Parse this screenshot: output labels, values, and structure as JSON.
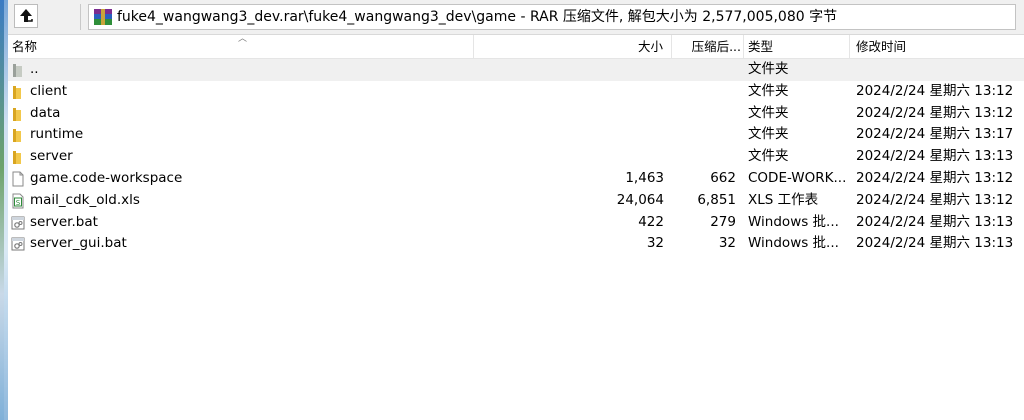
{
  "address": {
    "path_text": "fuke4_wangwang3_dev.rar\\fuke4_wangwang3_dev\\game - RAR 压缩文件, 解包大小为 2,577,005,080 字节"
  },
  "columns": {
    "name": "名称",
    "size": "大小",
    "packed": "压缩后...",
    "type": "类型",
    "modified": "修改时间"
  },
  "files": [
    {
      "name": "..",
      "size": "",
      "packed": "",
      "type": "文件夹",
      "modified": "",
      "icon": "folder-up-icon"
    },
    {
      "name": "client",
      "size": "",
      "packed": "",
      "type": "文件夹",
      "modified": "2024/2/24 星期六 13:12",
      "icon": "folder-icon"
    },
    {
      "name": "data",
      "size": "",
      "packed": "",
      "type": "文件夹",
      "modified": "2024/2/24 星期六 13:12",
      "icon": "folder-icon"
    },
    {
      "name": "runtime",
      "size": "",
      "packed": "",
      "type": "文件夹",
      "modified": "2024/2/24 星期六 13:17",
      "icon": "folder-icon"
    },
    {
      "name": "server",
      "size": "",
      "packed": "",
      "type": "文件夹",
      "modified": "2024/2/24 星期六 13:13",
      "icon": "folder-icon"
    },
    {
      "name": "game.code-workspace",
      "size": "1,463",
      "packed": "662",
      "type": "CODE-WORK...",
      "modified": "2024/2/24 星期六 13:12",
      "icon": "file-icon"
    },
    {
      "name": "mail_cdk_old.xls",
      "size": "24,064",
      "packed": "6,851",
      "type": "XLS 工作表",
      "modified": "2024/2/24 星期六 13:12",
      "icon": "spreadsheet-icon"
    },
    {
      "name": "server.bat",
      "size": "422",
      "packed": "279",
      "type": "Windows 批...",
      "modified": "2024/2/24 星期六 13:13",
      "icon": "batch-file-icon"
    },
    {
      "name": "server_gui.bat",
      "size": "32",
      "packed": "32",
      "type": "Windows 批...",
      "modified": "2024/2/24 星期六 13:13",
      "icon": "batch-file-icon"
    }
  ],
  "colors": {
    "folder": "#f2c84b",
    "header_border": "#e5e5e5",
    "parent_row_bg": "#f0f0f0"
  }
}
